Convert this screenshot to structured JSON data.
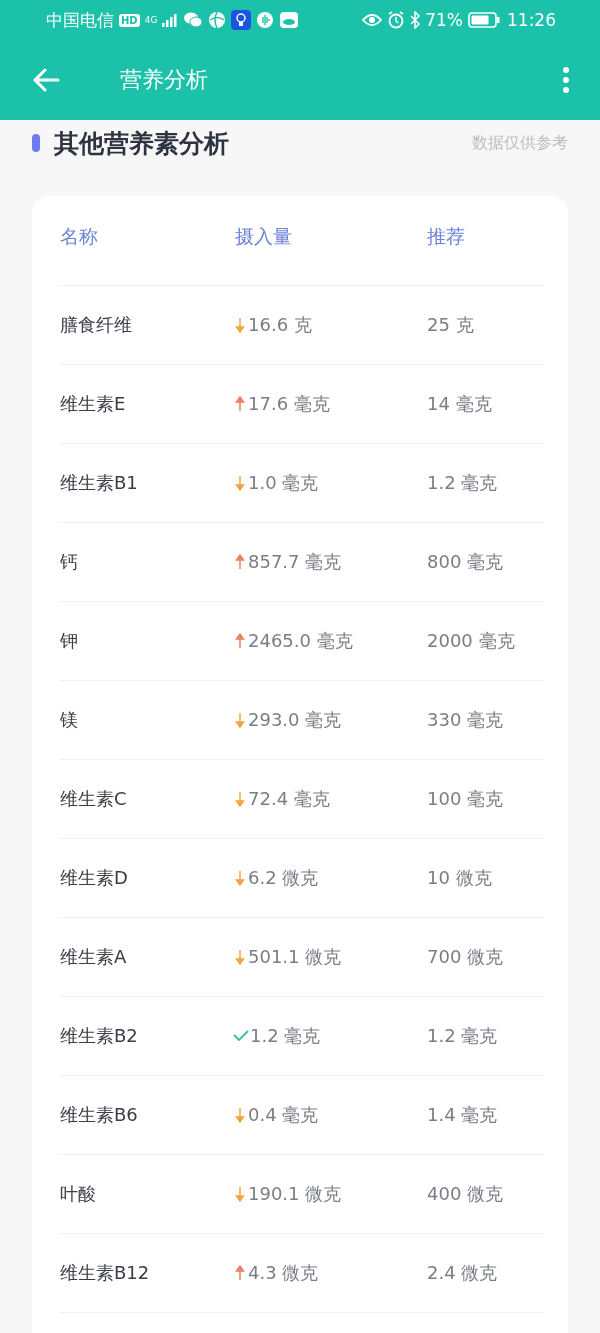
{
  "status_bar": {
    "carrier": "中国电信",
    "hd": "HD",
    "network": "4G",
    "battery": "71%",
    "time": "11:26"
  },
  "app_bar": {
    "title": "营养分析"
  },
  "section": {
    "title": "其他营养素分析",
    "note": "数据仅供参考"
  },
  "table": {
    "columns": [
      "名称",
      "摄入量",
      "推荐"
    ],
    "rows": [
      {
        "name": "膳食纤维",
        "kind": "low",
        "intake": "16.6 克",
        "recommended": "25 克"
      },
      {
        "name": "维生素E",
        "kind": "high",
        "intake": "17.6 毫克",
        "recommended": "14 毫克"
      },
      {
        "name": "维生素B1",
        "kind": "low",
        "intake": "1.0 毫克",
        "recommended": "1.2 毫克"
      },
      {
        "name": "钙",
        "kind": "high",
        "intake": "857.7 毫克",
        "recommended": "800 毫克"
      },
      {
        "name": "钾",
        "kind": "high",
        "intake": "2465.0 毫克",
        "recommended": "2000 毫克"
      },
      {
        "name": "镁",
        "kind": "low",
        "intake": "293.0 毫克",
        "recommended": "330 毫克"
      },
      {
        "name": "维生素C",
        "kind": "low",
        "intake": "72.4 毫克",
        "recommended": "100 毫克"
      },
      {
        "name": "维生素D",
        "kind": "low",
        "intake": "6.2 微克",
        "recommended": "10 微克"
      },
      {
        "name": "维生素A",
        "kind": "low",
        "intake": "501.1 微克",
        "recommended": "700 微克"
      },
      {
        "name": "维生素B2",
        "kind": "ok",
        "intake": "1.2 毫克",
        "recommended": "1.2 毫克"
      },
      {
        "name": "维生素B6",
        "kind": "low",
        "intake": "0.4 毫克",
        "recommended": "1.4 毫克"
      },
      {
        "name": "叶酸",
        "kind": "low",
        "intake": "190.1 微克",
        "recommended": "400 微克"
      },
      {
        "name": "维生素B12",
        "kind": "high",
        "intake": "4.3 微克",
        "recommended": "2.4 微克"
      }
    ]
  }
}
